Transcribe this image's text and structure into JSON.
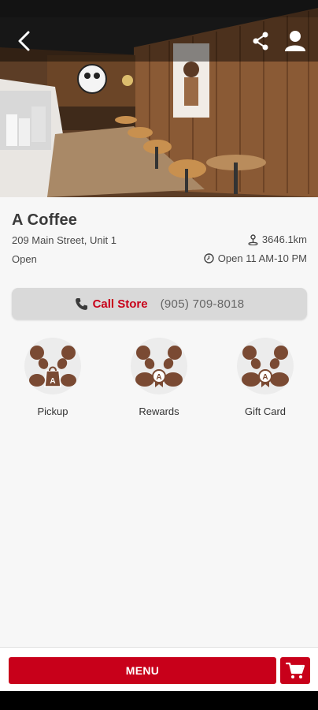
{
  "store": {
    "name": "A Coffee",
    "address": "209 Main Street, Unit 1",
    "distance": "3646.1km",
    "status": "Open",
    "hours": "Open 11 AM-10 PM"
  },
  "call": {
    "label": "Call Store",
    "phone": "(905) 709-8018"
  },
  "features": [
    {
      "label": "Pickup",
      "icon": "panda-bag-icon"
    },
    {
      "label": "Rewards",
      "icon": "panda-badge-icon"
    },
    {
      "label": "Gift Card",
      "icon": "panda-badge-icon"
    }
  ],
  "bottom": {
    "menu_label": "MENU"
  },
  "colors": {
    "accent": "#c8001a",
    "panda_brown": "#7a4a33"
  }
}
